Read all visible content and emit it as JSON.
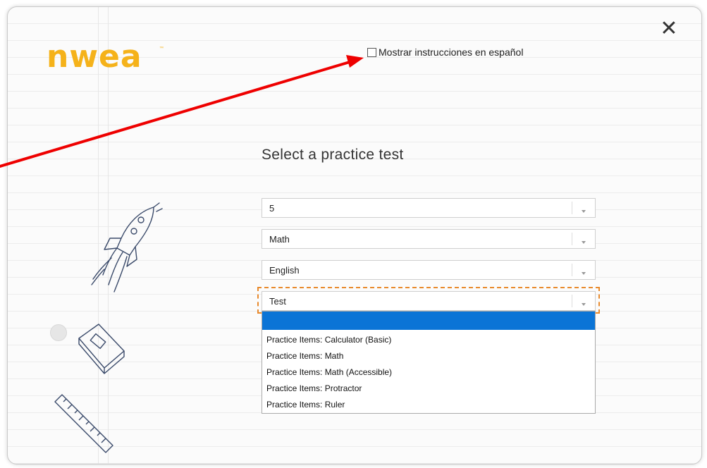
{
  "close": {
    "glyph": "✕"
  },
  "logo": {
    "text": "nwea",
    "trademark": "™"
  },
  "spanish_toggle": {
    "label": "Mostrar instrucciones en español",
    "checked": false
  },
  "heading": "Select a practice test",
  "selects": [
    {
      "value": "5"
    },
    {
      "value": "Math"
    },
    {
      "value": "English"
    },
    {
      "value": "Test"
    }
  ],
  "dropdown": {
    "options": [
      "",
      "Practice Items: Calculator (Basic)",
      "Practice Items: Math",
      "Practice Items: Math (Accessible)",
      "Practice Items: Protractor",
      "Practice Items: Ruler"
    ],
    "highlight_color": "#0b74d6"
  },
  "colors": {
    "brand": "#f5b21a",
    "focus_ring": "#e88a2d",
    "annotation_arrow": "#ee0000"
  },
  "icons": {
    "close": "close-icon",
    "rocket": "rocket-doodle-icon",
    "book": "book-doodle-icon",
    "ruler": "ruler-doodle-icon",
    "chevron": "chevron-down-icon"
  }
}
